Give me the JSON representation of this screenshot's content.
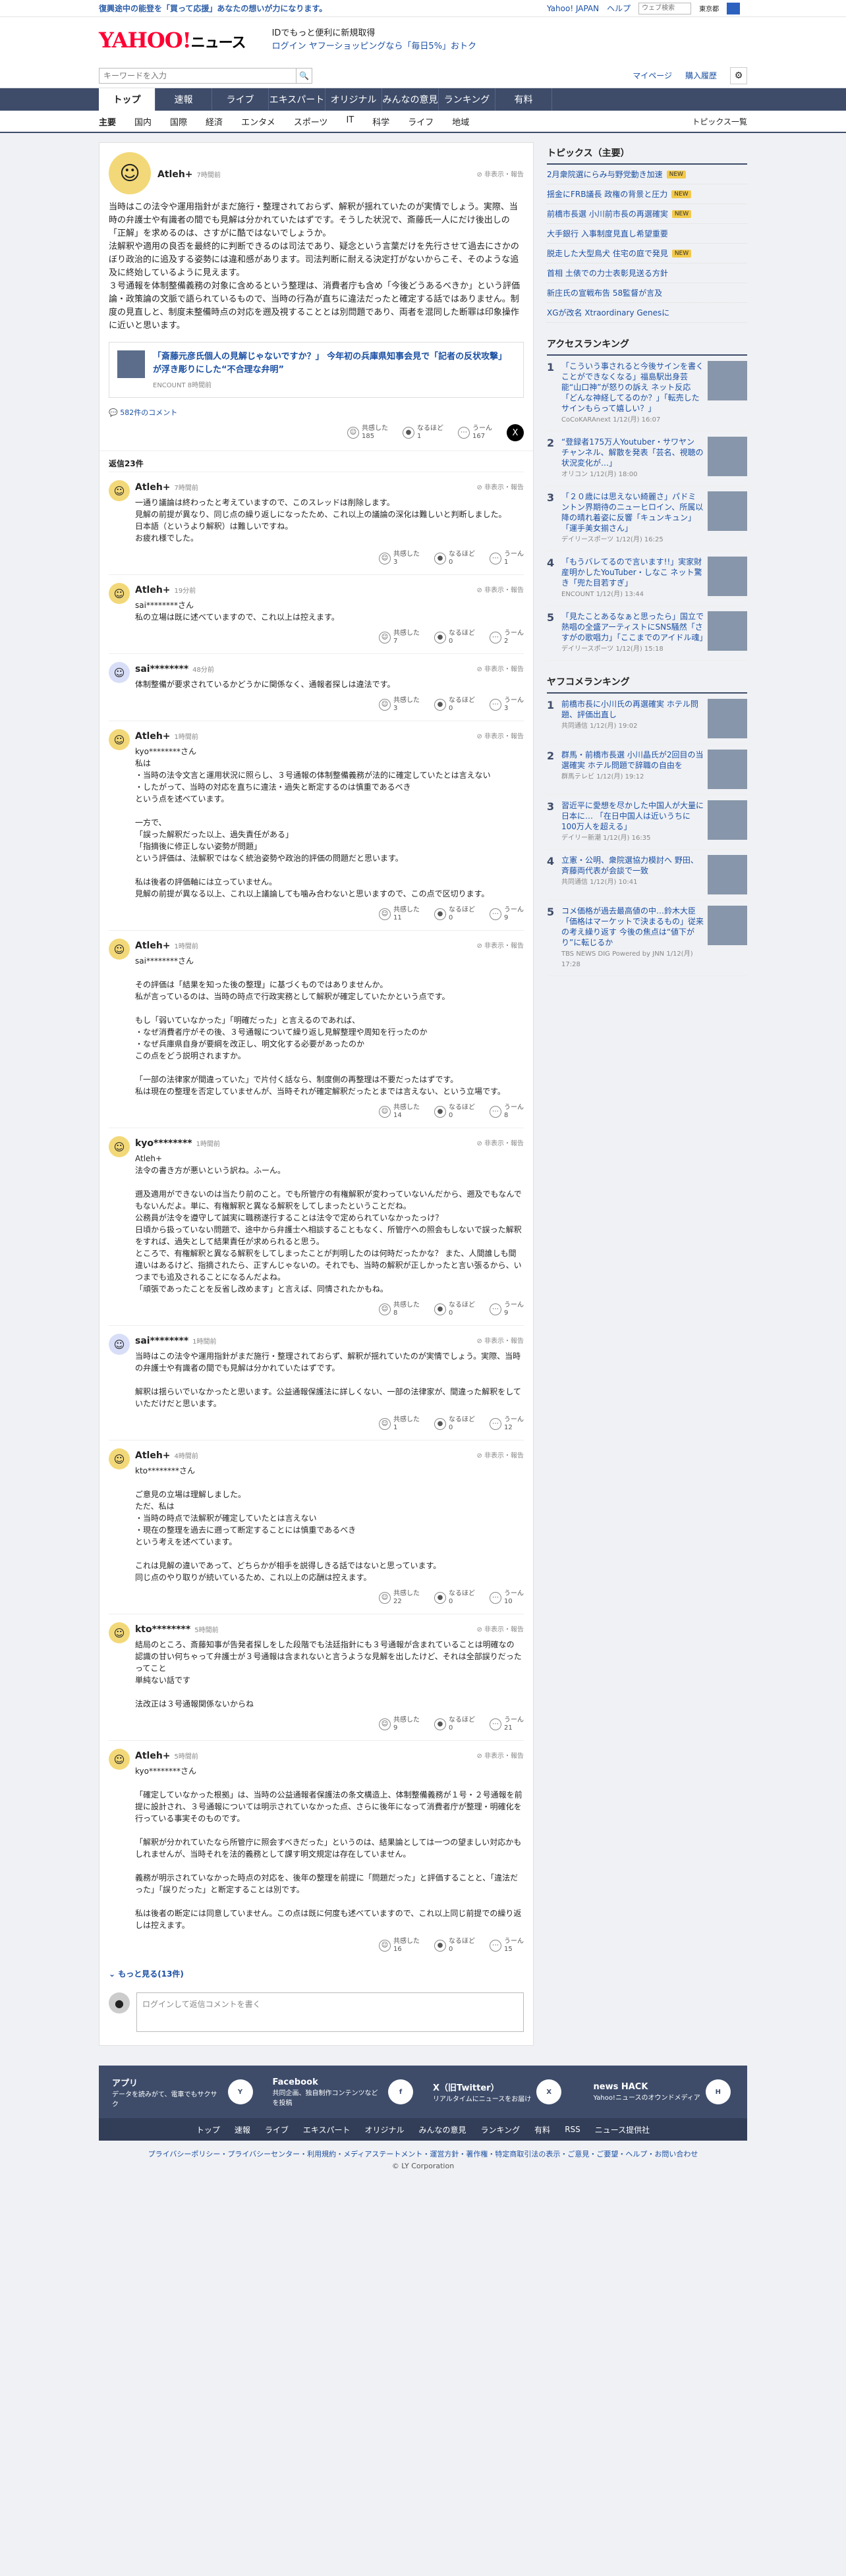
{
  "topbar": {
    "promo": "復興途中の能登を「買って応援」あなたの想いが力になります。",
    "links": [
      "Yahoo! JAPAN",
      "ヘルプ"
    ],
    "search_placeholder": "ウェブ検索",
    "region": "東京都"
  },
  "header": {
    "logo": "YAHOO!",
    "logo_sub": "ニュース",
    "msg1": "IDでもっと便利に新規取得",
    "msg2": "ログイン  ヤフーショッピングなら「毎日5%」おトク"
  },
  "search": {
    "placeholder": "キーワードを入力",
    "links": [
      "マイページ",
      "購入履歴"
    ]
  },
  "catnav": [
    "トップ",
    "速報",
    "ライブ",
    "エキスパート",
    "オリジナル",
    "みんなの意見",
    "ランキング",
    "有料"
  ],
  "subnav": {
    "items": [
      "主要",
      "国内",
      "国際",
      "経済",
      "エンタメ",
      "スポーツ",
      "IT",
      "科学",
      "ライフ",
      "地域"
    ],
    "right": "トピックス一覧"
  },
  "main_post": {
    "user": "Atleh+",
    "time": "7時間前",
    "flag": "非表示・報告",
    "body": "当時はこの法令や運用指針がまだ施行・整理されておらず、解釈が揺れていたのが実情でしょう。実際、当時の弁護士や有識者の間でも見解は分かれていたはずです。そうした状況で、斎藤氏一人にだけ後出しの「正解」を求めるのは、さすがに酷ではないでしょうか。\n法解釈や適用の良否を最終的に判断できるのは司法であり、疑念という言葉だけを先行させて過去にさかのぼり政治的に追及する姿勢には違和感があります。司法判断に耐える決定打がないからこそ、そのような追及に終始しているように見えます。\n３号通報を体制整備義務の対象に含めるという整理は、消費者庁も含め「今後どうあるべきか」という評価論・政策論の文脈で語られているもので、当時の行為が直ちに違法だったと確定する話ではありません。制度の見直しと、制度未整備時点の対応を遡及視することとは別問題であり、両者を混同した断罪は印象操作に近いと思います。",
    "article_title": "「斎藤元彦氏個人の見解じゃないですか？」 今年初の兵庫県知事会見で「記者の反状攻撃」が浮き彫りにした“不合理な弁明”",
    "article_src": "ENCOUNT 8時間前",
    "comment_count": "582件のコメント",
    "reactions": [
      {
        "label": "共感した",
        "count": "185"
      },
      {
        "label": "なるほど",
        "count": "1"
      },
      {
        "label": "うーん",
        "count": "167"
      }
    ]
  },
  "reply_header": "返信23件",
  "replies": [
    {
      "user": "Atleh+",
      "time": "7時間前",
      "body": "一通り議論は終わったと考えていますので、このスレッドは削除します。\n見解の前提が異なり、同じ点の繰り返しになったため、これ以上の議論の深化は難しいと判断しました。\n日本語（というより解釈）は難しいですね。\nお疲れ様でした。",
      "r": [
        "3",
        "0",
        "1"
      ]
    },
    {
      "user": "Atleh+",
      "time": "19分前",
      "body": "sai********さん\n私の立場は既に述べていますので、これ以上は控えます。",
      "r": [
        "7",
        "0",
        "2"
      ]
    },
    {
      "user": "sai********",
      "time": "48分前",
      "body": "体制整備が要求されているかどうかに関係なく、通報者探しは違法です。",
      "r": [
        "3",
        "0",
        "3"
      ]
    },
    {
      "user": "Atleh+",
      "time": "1時間前",
      "body": "kyo********さん\n私は\n・当時の法令文言と運用状況に照らし、３号通報の体制整備義務が法的に確定していたとは言えない\n・したがって、当時の対応を直ちに違法・過失と断定するのは慎重であるべき\nという点を述べています。\n\n一方で、\n「誤った解釈だった以上、過失責任がある」\n「指摘後に修正しない姿勢が問題」\nという評価は、法解釈ではなく統治姿勢や政治的評価の問題だと思います。\n\n私は後者の評価軸には立っていません。\n見解の前提が異なる以上、これ以上議論しても噛み合わないと思いますので、この点で区切ります。",
      "r": [
        "11",
        "0",
        "9"
      ]
    },
    {
      "user": "Atleh+",
      "time": "1時間前",
      "body": "sai********さん\n\nその評価は「結果を知った後の整理」に基づくものではありませんか。\n私が言っているのは、当時の時点で行政実務として解釈が確定していたかという点です。\n\nもし「弱いていなかった」「明確だった」と言えるのであれば、\n・なぜ消費者庁がその後、３号通報について繰り返し見解整理や周知を行ったのか\n・なぜ兵庫県自身が要綱を改正し、明文化する必要があったのか\nこの点をどう説明されますか。\n\n「一部の法律家が間違っていた」で片付く話なら、制度側の再整理は不要だったはずです。\n私は現在の整理を否定していませんが、当時それが確定解釈だったとまでは言えない、という立場です。",
      "r": [
        "14",
        "0",
        "8"
      ]
    },
    {
      "user": "kyo********",
      "time": "1時間前",
      "body": "Atleh+\n法令の書き方が悪いという訳ね。ふーん。\n\n遡及適用ができないのは当たり前のこと。でも所管庁の有権解釈が変わっていないんだから、遡及でもなんでもないんだよ。単に、有権解釈と異なる解釈をしてしまったということだね。\n公務員が法令を遵守して誠実に職務遂行することは法令で定められていなかったっけ？\n日頃から扱っていない問題で、途中から弁護士へ相談することもなく、所管庁への照会もしないで誤った解釈をすれば、過失として結果責任が求められると思う。\nところで、有権解釈と異なる解釈をしてしまったことが判明したのは何時だったかな？ また、人間誰しも間違いはあるけど、指摘されたら、正すんじゃないの。それでも、当時の解釈が正しかったと言い張るから、いつまでも追及されることになるんだよね。\n「頑張であったことを反省し改めます」と言えば、同情されたかもね。",
      "r": [
        "8",
        "0",
        "9"
      ]
    },
    {
      "user": "sai********",
      "time": "1時間前",
      "body": "当時はこの法令や運用指針がまだ施行・整理されておらず、解釈が揺れていたのが実情でしょう。実際、当時の弁護士や有識者の間でも見解は分かれていたはずです。\n\n解釈は揺らいでいなかったと思います。公益通報保護法に詳しくない、一部の法律家が、間違った解釈をしていただけだと思います。",
      "r": [
        "1",
        "0",
        "12"
      ]
    },
    {
      "user": "Atleh+",
      "time": "4時間前",
      "body": "kto********さん\n\nご意見の立場は理解しました。\nただ、私は\n・当時の時点で法解釈が確定していたとは言えない\n・現在の整理を過去に遡って断定することには慎重であるべき\nという考えを述べています。\n\nこれは見解の違いであって、どちらかが相手を説得しきる話ではないと思っています。\n同じ点のやり取りが続いているため、これ以上の応酬は控えます。",
      "r": [
        "22",
        "0",
        "10"
      ]
    },
    {
      "user": "kto********",
      "time": "5時間前",
      "body": "結局のところ、斎藤知事が告発者探しをした段階でも法廷指針にも３号通報が含まれていることは明確なの\n認識の甘い何ちゃって弁護士が３号通報は含まれないと言うような見解を出したけど、それは全部誤りだったってこと\n単純ない話です\n\n法改正は３号通報関係ないからね",
      "r": [
        "9",
        "0",
        "21"
      ]
    },
    {
      "user": "Atleh+",
      "time": "5時間前",
      "body": "kyo********さん\n\n「確定していなかった根拠」は、当時の公益通報者保護法の条文構造上、体制整備義務が１号・２号通報を前提に設計され、３号通報については明示されていなかった点、さらに後年になって消費者庁が整理・明確化を行っている事実そのものです。\n\n「解釈が分かれていたなら所管庁に照会すべきだった」というのは、結果論としては一つの望ましい対応かもしれませんが、当時それを法的義務として課す明文規定は存在していません。\n\n義務が明示されていなかった時点の対応を、後年の整理を前提に「問題だった」と評価することと、「違法だった」「誤りだった」と断定することは別です。\n\n私は後者の断定には同意していません。この点は既に何度も述べていますので、これ以上同じ前提での繰り返しは控えます。",
      "r": [
        "16",
        "0",
        "15"
      ]
    }
  ],
  "more": "もっと見る(13件)",
  "comment_box": "ログインして返信コメントを書く",
  "reaction_labels": [
    "共感した",
    "なるほど",
    "うーん"
  ],
  "topics": {
    "title": "トピックス（主要）",
    "items": [
      {
        "t": "2月衆院選にらみ与野党動き加速",
        "b": "NEW"
      },
      {
        "t": "揺金にFRB議長 政権の背景と圧力",
        "b": "NEW"
      },
      {
        "t": "前橋市長選 小川前市長の再選確実",
        "b": "NEW"
      },
      {
        "t": "大手銀行 入事制度見直し希望重要",
        "b": ""
      },
      {
        "t": "脱走した大型鳥犬 住宅の庭で発見",
        "b": "NEW"
      },
      {
        "t": "首相 土俵での力士表彰見送る方針",
        "b": ""
      },
      {
        "t": "新庄氏の宣戦布告 58監督が言及",
        "b": ""
      },
      {
        "t": "XGが改名 Xtraordinary Genesに",
        "b": ""
      }
    ]
  },
  "access_ranking": {
    "title": "アクセスランキング",
    "items": [
      {
        "t": "「こういう事されると今後サインを書くことができなくなる」福島駅出身芸能“山口神”が怒りの訴え ネット反応「どんな神経してるのか？」「転売したサインもらって嬉しい？」",
        "m": "CoCoKARAnext 1/12(月) 16:07"
      },
      {
        "t": "“登録者175万人Youtuber・サワヤン チャンネル、解散を発表「芸名、視聴の状況変化が…」",
        "m": "オリコン 1/12(月) 18:00"
      },
      {
        "t": "「２０歳には思えない綺麗さ」パドミントン界期待のニューヒロイン、所属以降の晴れ着姿に反響「キュンキュン」「運手美女揃さん」",
        "m": "デイリースポーツ 1/12(月) 16:25"
      },
      {
        "t": "「もうバレてるので言います!!」実家財産明かしたYouTuber・しなこ ネット驚き「兜た目若すぎ」",
        "m": "ENCOUNT 1/12(月) 13:44"
      },
      {
        "t": "「見たことあるなぁと思ったら」国立で熱唱の全盛アーティストにSNS騒然「さすがの歌唱力」「ここまでのアイドル魂」",
        "m": "デイリースポーツ 1/12(月) 15:18"
      }
    ]
  },
  "comment_ranking": {
    "title": "ヤフコメランキング",
    "items": [
      {
        "t": "前橋市長に小川氏の再選確実 ホテル問題、評価出直し",
        "m": "共同通信 1/12(月) 19:02"
      },
      {
        "t": "群馬・前橋市長選 小川晶氏が2回目の当選確実 ホテル問題で辞職の自由を",
        "m": "群馬テレビ 1/12(月) 19:12"
      },
      {
        "t": "習近平に愛想を尽かした中国人が大量に日本に… 「在日中国人は近いうちに100万人を超える」",
        "m": "デイリー新潮 1/12(月) 16:35"
      },
      {
        "t": "立憲・公明、衆院選協力模討へ 野田、斉藤両代表が会談で一致",
        "m": "共同通信 1/12(月) 10:41"
      },
      {
        "t": "コメ価格が過去最高値の中…鈴木大臣「価格はマーケットで決まるもの」従来の考え繰り返す 今後の焦点は“値下がり”に転じるか",
        "m": "TBS NEWS DIG Powered by JNN 1/12(月) 17:28"
      }
    ]
  },
  "footer": {
    "apps": [
      {
        "name": "アプリ",
        "desc": "データを読みがて、電車でもサクサク",
        "icon": "Y"
      },
      {
        "name": "Facebook",
        "desc": "共同企画、独自制作コンテンツなどを投稿",
        "icon": "f"
      },
      {
        "name": "X（旧Twitter）",
        "desc": "リアルタイムにニュースをお届け",
        "icon": "X"
      },
      {
        "name": "news HACK",
        "desc": "Yahoo!ニュースのオウンドメディア",
        "icon": "H"
      }
    ],
    "nav": [
      "トップ",
      "速報",
      "ライブ",
      "エキスパート",
      "オリジナル",
      "みんなの意見",
      "ランキング",
      "有料",
      "RSS",
      "ニュース提供社"
    ],
    "links": "プライバシーポリシー・プライバシーセンター・利用規約・メディアステートメント・運営方針・著作権・特定商取引法の表示・ご意見・ご要望・ヘルプ・お問い合わせ",
    "copyright": "© LY Corporation"
  }
}
